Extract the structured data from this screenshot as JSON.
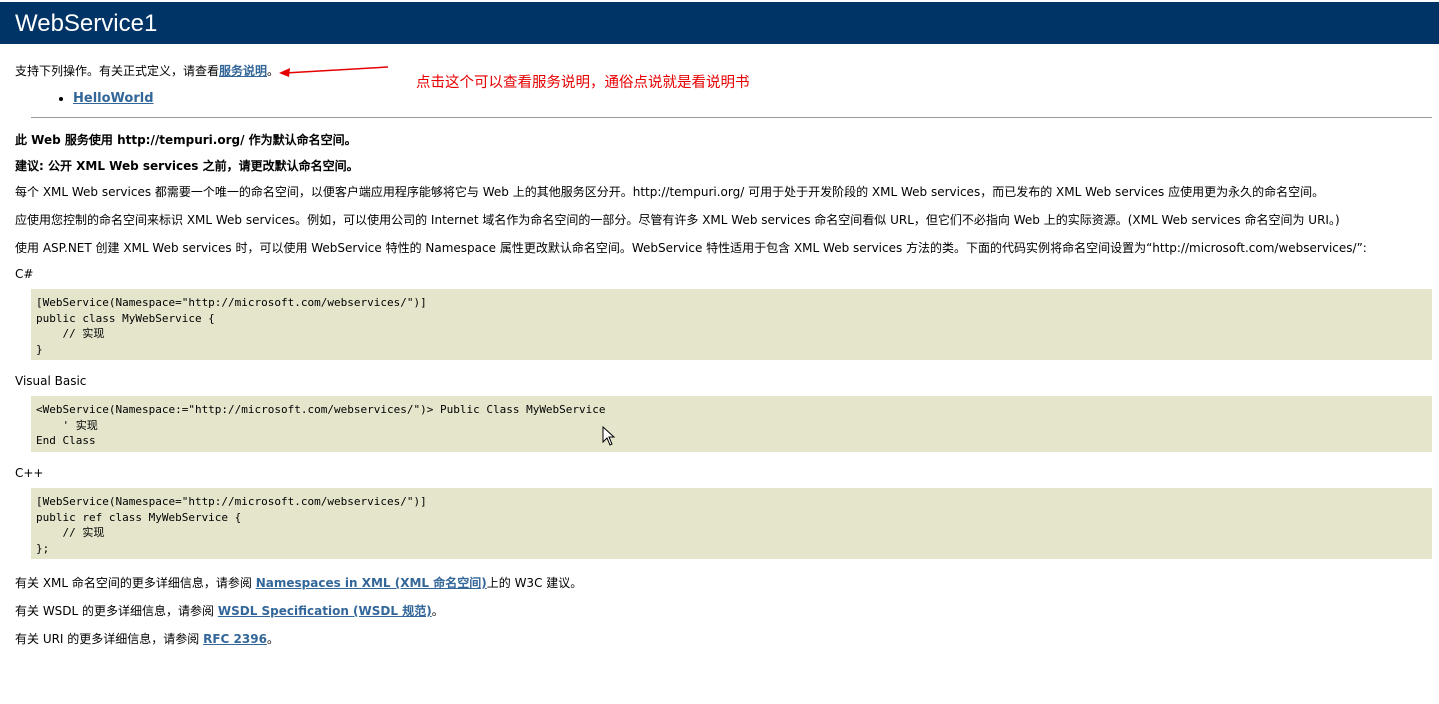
{
  "header": {
    "title": "WebService1"
  },
  "intro": {
    "prefix": "支持下列操作。有关正式定义，请查看",
    "link": "服务说明",
    "suffix": "。"
  },
  "operations": [
    "HelloWorld"
  ],
  "annotation": {
    "text": "点击这个可以查看服务说明，通俗点说就是看说明书",
    "color": "#e60000"
  },
  "namespace_info": {
    "line1": "此 Web 服务使用 http://tempuri.org/ 作为默认命名空间。",
    "line2": "建议: 公开 XML Web services 之前，请更改默认命名空间。",
    "para1": "每个 XML Web services 都需要一个唯一的命名空间，以便客户端应用程序能够将它与 Web 上的其他服务区分开。http://tempuri.org/ 可用于处于开发阶段的 XML Web services，而已发布的 XML Web services 应使用更为永久的命名空间。",
    "para2": "应使用您控制的命名空间来标识 XML Web services。例如，可以使用公司的 Internet 域名作为命名空间的一部分。尽管有许多 XML Web services 命名空间看似 URL，但它们不必指向 Web 上的实际资源。(XML Web services 命名空间为 URI。)",
    "para3": "使用 ASP.NET 创建 XML Web services 时，可以使用 WebService 特性的 Namespace 属性更改默认命名空间。WebService 特性适用于包含 XML Web services 方法的类。下面的代码实例将命名空间设置为“http://microsoft.com/webservices/”:"
  },
  "samples": [
    {
      "lang": "C#",
      "code": "[WebService(Namespace=\"http://microsoft.com/webservices/\")]\npublic class MyWebService {\n    // 实现\n}"
    },
    {
      "lang": "Visual Basic",
      "code": "<WebService(Namespace:=\"http://microsoft.com/webservices/\")> Public Class MyWebService\n    ' 实现\nEnd Class"
    },
    {
      "lang": "C++",
      "code": "[WebService(Namespace=\"http://microsoft.com/webservices/\")]\npublic ref class MyWebService {\n    // 实现\n};"
    }
  ],
  "references": [
    {
      "prefix": "有关 XML 命名空间的更多详细信息，请参阅 ",
      "link": "Namespaces in XML (XML 命名空间)",
      "suffix": "上的 W3C 建议。"
    },
    {
      "prefix": "有关 WSDL 的更多详细信息，请参阅 ",
      "link": "WSDL Specification (WSDL 规范)",
      "suffix": "。"
    },
    {
      "prefix": "有关 URI 的更多详细信息，请参阅 ",
      "link": "RFC 2396",
      "suffix": "。"
    }
  ],
  "colors": {
    "banner": "#003366",
    "link": "#336699",
    "code_bg": "#e5e5cc"
  }
}
